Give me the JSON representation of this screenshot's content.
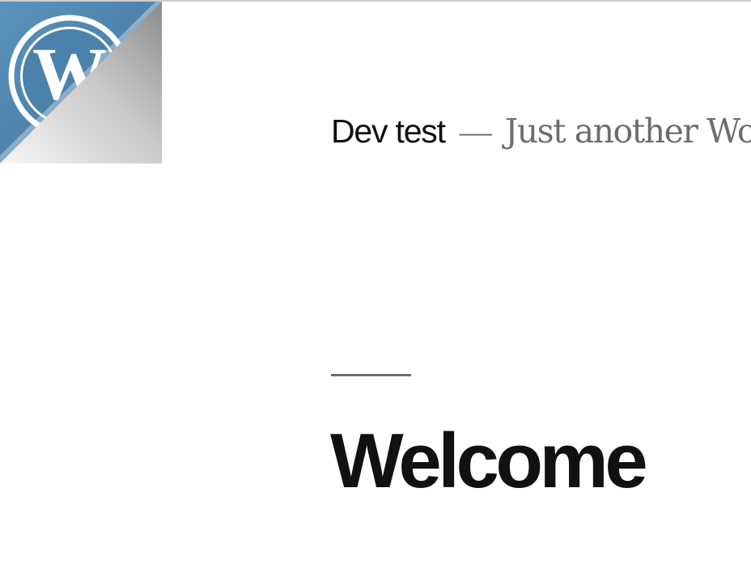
{
  "header": {
    "site_title": "Dev test",
    "separator": "—",
    "site_description": "Just another WordPress site",
    "logo_icon": "wordpress-logo-icon"
  },
  "post": {
    "title": "Welcome"
  },
  "colors": {
    "logo_blue": "#4a82ac",
    "text_dark": "#111111",
    "text_muted": "#6d6d6d"
  }
}
